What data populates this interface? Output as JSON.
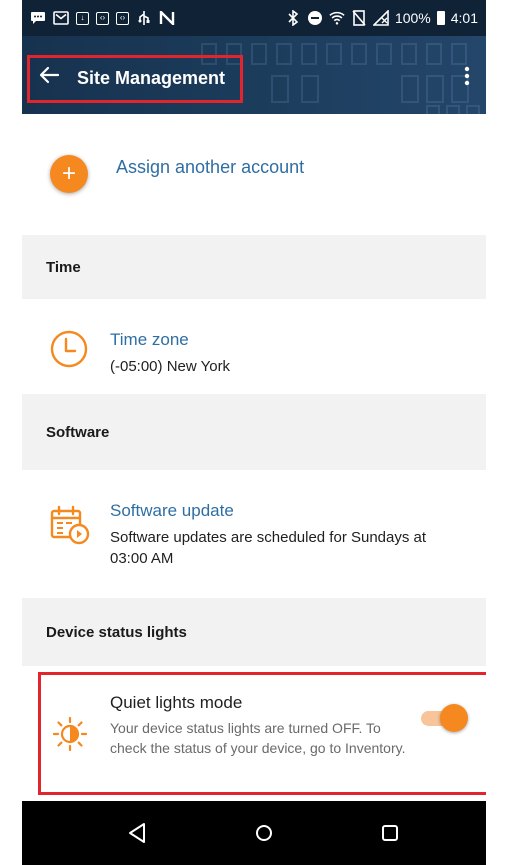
{
  "status_bar": {
    "battery": "100%",
    "time": "4:01"
  },
  "app_bar": {
    "title": "Site Management"
  },
  "account": {
    "assign_label": "Assign another account"
  },
  "sections": {
    "time": {
      "header": "Time",
      "title": "Time zone",
      "value": "(-05:00) New York"
    },
    "software": {
      "header": "Software",
      "title": "Software update",
      "value_line1": "Software updates are scheduled for Sundays at",
      "value_line2": "03:00 AM"
    },
    "device_status": {
      "header": "Device status lights",
      "title": "Quiet lights mode",
      "description": "Your device status lights are turned OFF. To check the status of your device, go to Inventory.",
      "toggle_on": true
    }
  },
  "colors": {
    "accent": "#f5891f",
    "link": "#2f6ea3",
    "highlight": "#e2242c",
    "app_bar": "#1b3b5a"
  },
  "icons": {
    "back": "back-arrow-icon",
    "menu": "more-vert-icon",
    "plus": "plus-icon",
    "clock": "clock-icon",
    "calendar": "calendar-update-icon",
    "light": "light-brightness-icon"
  }
}
